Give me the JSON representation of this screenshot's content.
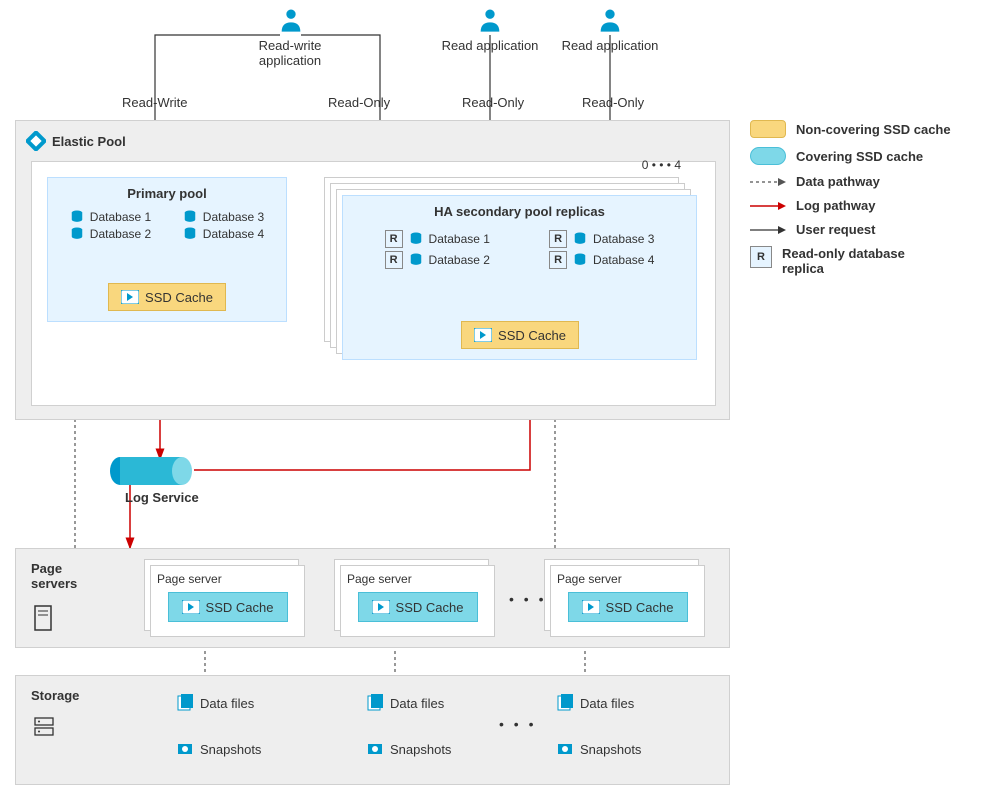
{
  "users": {
    "readWriteApp": "Read-write\napplication",
    "readApp1": "Read application",
    "readApp2": "Read application",
    "labels": {
      "readWrite": "Read-Write",
      "readOnly1": "Read-Only",
      "readOnly2": "Read-Only",
      "readOnly3": "Read-Only"
    }
  },
  "elasticPool": {
    "title": "Elastic Pool",
    "primaryPool": {
      "title": "Primary pool",
      "databases": [
        "Database 1",
        "Database 2",
        "Database 3",
        "Database 4"
      ],
      "cache": "SSD Cache"
    },
    "secondaryPool": {
      "replicaRange": "0 • • • 4",
      "title": "HA secondary pool replicas",
      "databases": [
        "Database 1",
        "Database 2",
        "Database 3",
        "Database 4"
      ],
      "cache": "SSD Cache",
      "replicaBadge": "R"
    }
  },
  "logService": "Log Service",
  "pageServers": {
    "title": "Page\nservers",
    "serverLabel": "Page server",
    "cache": "SSD Cache",
    "ellipsis": "• • •"
  },
  "storage": {
    "title": "Storage",
    "dataFiles": "Data files",
    "snapshots": "Snapshots",
    "ellipsis": "• • •"
  },
  "legend": {
    "nonCovering": "Non-covering SSD cache",
    "covering": "Covering SSD cache",
    "dataPath": "Data pathway",
    "logPath": "Log pathway",
    "userReq": "User request",
    "readOnlyReplica": "Read-only database\nreplica",
    "rBadge": "R"
  },
  "colors": {
    "yellow": "#f9d77e",
    "cyan": "#7ed8e8",
    "red": "#cc0000",
    "blue": "#0099cc",
    "gray": "#eeeeee"
  }
}
